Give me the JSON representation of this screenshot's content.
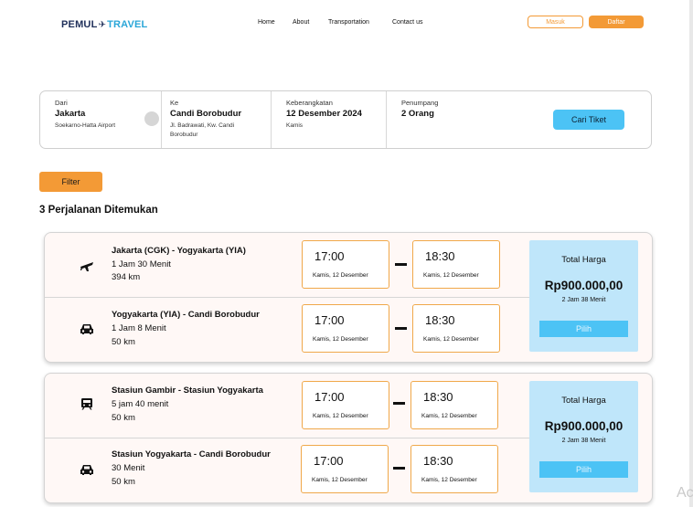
{
  "brand": {
    "part1": "PEMUL",
    "part2": "TRAVEL"
  },
  "nav": {
    "home": "Home",
    "about": "About",
    "transportation": "Transportation",
    "contact": "Contact us"
  },
  "auth": {
    "login": "Masuk",
    "register": "Daftar"
  },
  "search": {
    "from_label": "Dari",
    "from_city": "Jakarta",
    "from_place": "Soekarno-Hatta Airport",
    "to_label": "Ke",
    "to_city": "Candi Borobudur",
    "to_place_1": "Jl. Badrawati, Kw. Candi",
    "to_place_2": "Borobudur",
    "depart_label": "Keberangkatan",
    "depart_date": "12 Desember 2024",
    "depart_day": "Kamis",
    "pax_label": "Penumpang",
    "pax_value": "2 Orang",
    "search_button": "Cari Tiket"
  },
  "filter_label": "Filter",
  "results_title": "3 Perjalanan Ditemukan",
  "trips": [
    {
      "segments": [
        {
          "icon": "airplane-icon",
          "title": "Jakarta (CGK) - Yogyakarta (YIA)",
          "duration": "1 Jam 30 Menit",
          "distance": "394 km",
          "depart_time": "17:00",
          "depart_date": "Kamis, 12 Desember",
          "arrive_time": "18:30",
          "arrive_date": "Kamis, 12 Desember"
        },
        {
          "icon": "car-icon",
          "title": "Yogyakarta (YIA) - Candi Borobudur",
          "duration": "1 Jam 8 Menit",
          "distance": "50 km",
          "depart_time": "17:00",
          "depart_date": "Kamis, 12 Desember",
          "arrive_time": "18:30",
          "arrive_date": "Kamis, 12 Desember"
        }
      ],
      "price_label": "Total Harga",
      "price": "Rp900.000,00",
      "total_duration": "2 Jam 38 Menit",
      "select": "Pilih"
    },
    {
      "segments": [
        {
          "icon": "train-icon",
          "title": "Stasiun Gambir - Stasiun Yogyakarta",
          "duration": "5 jam 40 menit",
          "distance": "50 km",
          "depart_time": "17:00",
          "depart_date": "Kamis, 12 Desember",
          "arrive_time": "18:30",
          "arrive_date": "Kamis, 12 Desember"
        },
        {
          "icon": "car-icon",
          "title": "Stasiun Yogyakarta - Candi Borobudur",
          "duration": "30 Menit",
          "distance": "50 km",
          "depart_time": "17:00",
          "depart_date": "Kamis, 12 Desember",
          "arrive_time": "18:30",
          "arrive_date": "Kamis, 12 Desember"
        }
      ],
      "price_label": "Total Harga",
      "price": "Rp900.000,00",
      "total_duration": "2 Jam 38 Menit",
      "select": "Pilih"
    }
  ],
  "watermark": "Ac",
  "colors": {
    "accent_orange": "#f39a36",
    "accent_blue": "#4cc3f5",
    "price_panel": "#bfe6fa",
    "brand_navy": "#1f2f5a",
    "brand_cyan": "#2aa6d8"
  }
}
